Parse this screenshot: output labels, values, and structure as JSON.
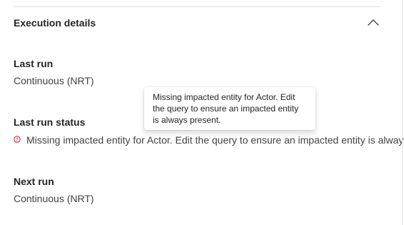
{
  "section": {
    "title": "Execution details",
    "expanded": true,
    "toggle_icon": "chevron-up-icon"
  },
  "last_run": {
    "label": "Last run",
    "value": "Continuous (NRT)"
  },
  "last_run_status": {
    "label": "Last run status",
    "icon": "error-circle-icon",
    "icon_color": "#c50f1f",
    "message": "Missing impacted entity for Actor. Edit the query to ensure an impacted entity is always present."
  },
  "tooltip": {
    "text": "Missing impacted entity for Actor. Edit the query to ensure an impacted entity is always present."
  },
  "next_run": {
    "label": "Next run",
    "value": "Continuous (NRT)"
  }
}
